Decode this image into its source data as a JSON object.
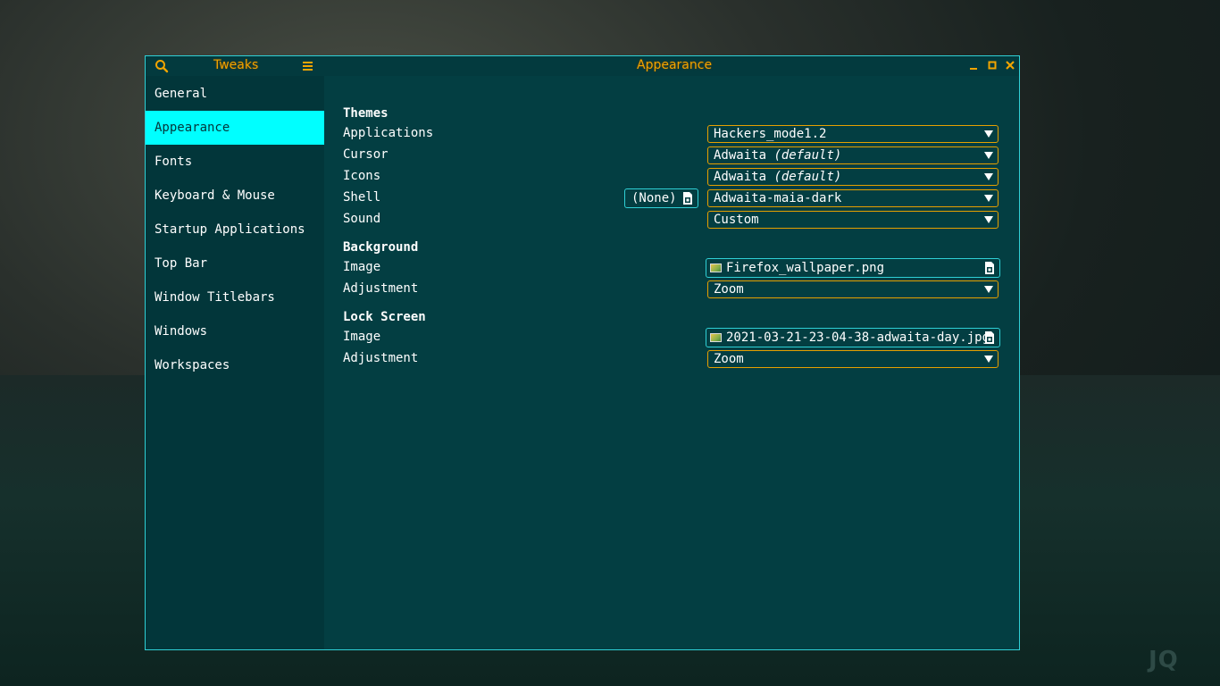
{
  "sidebar": {
    "title": "Tweaks",
    "items": [
      {
        "label": "General"
      },
      {
        "label": "Appearance"
      },
      {
        "label": "Fonts"
      },
      {
        "label": "Keyboard & Mouse"
      },
      {
        "label": "Startup Applications"
      },
      {
        "label": "Top Bar"
      },
      {
        "label": "Window Titlebars"
      },
      {
        "label": "Windows"
      },
      {
        "label": "Workspaces"
      }
    ],
    "active_index": 1
  },
  "header": {
    "title": "Appearance"
  },
  "themes": {
    "title": "Themes",
    "applications": {
      "label": "Applications",
      "value": "Hackers_mode1.2"
    },
    "cursor": {
      "label": "Cursor",
      "value": "Adwaita",
      "suffix": "(default)"
    },
    "icons": {
      "label": "Icons",
      "value": "Adwaita",
      "suffix": "(default)"
    },
    "shell": {
      "label": "Shell",
      "file_button": "(None)",
      "value": "Adwaita-maia-dark"
    },
    "sound": {
      "label": "Sound",
      "value": "Custom"
    }
  },
  "background": {
    "title": "Background",
    "image": {
      "label": "Image",
      "value": "Firefox_wallpaper.png"
    },
    "adjustment": {
      "label": "Adjustment",
      "value": "Zoom"
    }
  },
  "lock_screen": {
    "title": "Lock Screen",
    "image": {
      "label": "Image",
      "value": "2021-03-21-23-04-38-adwaita-day.jpg"
    },
    "adjustment": {
      "label": "Adjustment",
      "value": "Zoom"
    }
  },
  "wallpaper_watermark": "JQ",
  "colors": {
    "accent_orange": "#f0a400",
    "accent_cyan": "#00ffff",
    "window_bg": "#033e42",
    "sidebar_bg": "#02363a"
  }
}
